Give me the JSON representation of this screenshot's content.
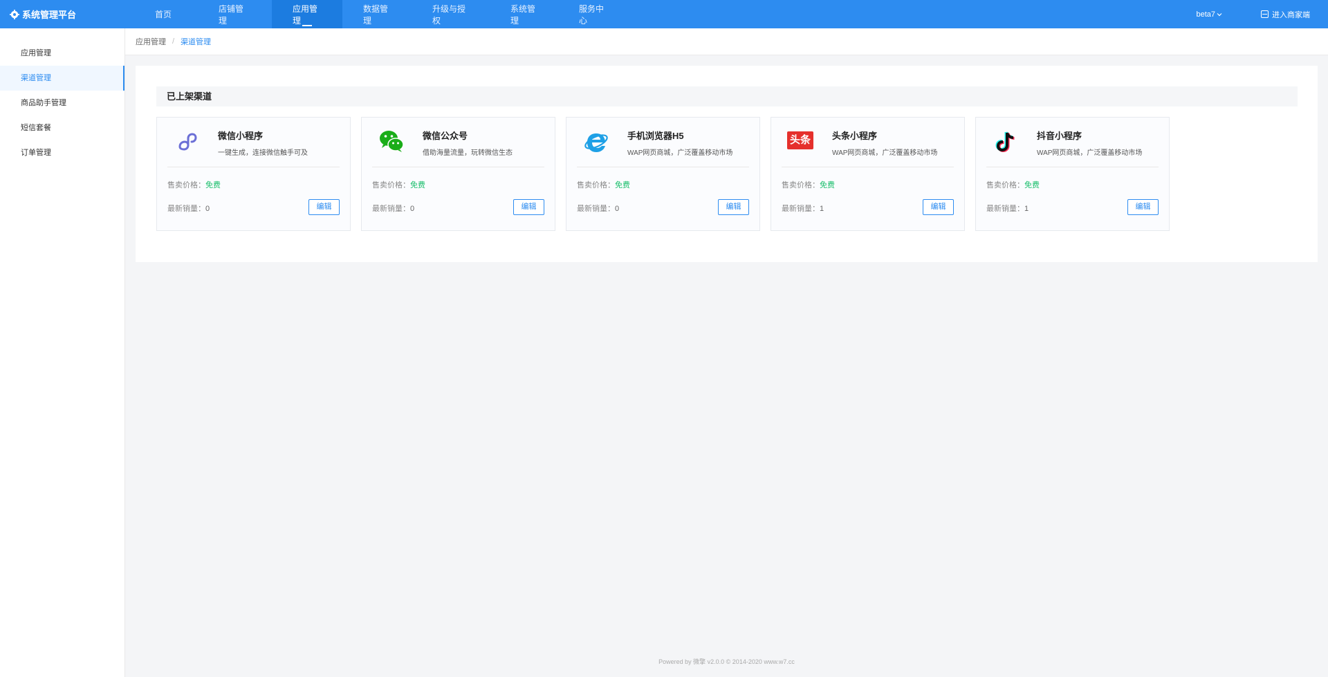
{
  "header": {
    "brand": "系统管理平台",
    "nav": [
      {
        "label": "首页",
        "active": false
      },
      {
        "label": "店铺管理",
        "active": false
      },
      {
        "label": "应用管理",
        "active": true
      },
      {
        "label": "数据管理",
        "active": false
      },
      {
        "label": "升级与授权",
        "active": false
      },
      {
        "label": "系统管理",
        "active": false
      },
      {
        "label": "服务中心",
        "active": false
      }
    ],
    "version": "beta7",
    "enter_merchant": "进入商家端"
  },
  "sidebar": {
    "items": [
      {
        "label": "应用管理",
        "active": false
      },
      {
        "label": "渠道管理",
        "active": true
      },
      {
        "label": "商品助手管理",
        "active": false
      },
      {
        "label": "短信套餐",
        "active": false
      },
      {
        "label": "订单管理",
        "active": false
      }
    ]
  },
  "breadcrumb": {
    "first": "应用管理",
    "separator": "/",
    "current": "渠道管理"
  },
  "section": {
    "title": "已上架渠道"
  },
  "labels": {
    "price": "售卖价格：",
    "sales": "最新销量：",
    "edit": "编辑"
  },
  "channels": [
    {
      "name": "微信小程序",
      "desc": "一键生成，连接微信触手可及",
      "price": "免费",
      "sales": "0",
      "icon": "miniprogram-icon"
    },
    {
      "name": "微信公众号",
      "desc": "借助海量流量，玩转微信生态",
      "price": "免费",
      "sales": "0",
      "icon": "wechat-icon"
    },
    {
      "name": "手机浏览器H5",
      "desc": "WAP网页商城，广泛覆盖移动市场",
      "price": "免费",
      "sales": "0",
      "icon": "browser-e-icon"
    },
    {
      "name": "头条小程序",
      "desc": "WAP网页商城，广泛覆盖移动市场",
      "price": "免费",
      "sales": "1",
      "icon": "toutiao-icon"
    },
    {
      "name": "抖音小程序",
      "desc": "WAP网页商城，广泛覆盖移动市场",
      "price": "免费",
      "sales": "1",
      "icon": "douyin-icon"
    }
  ],
  "icon_text": {
    "toutiao": "头条"
  },
  "colors": {
    "primary": "#2d8cf0",
    "free": "#19be6b"
  },
  "footer": "Powered by 微擎 v2.0.0 © 2014-2020 www.w7.cc"
}
